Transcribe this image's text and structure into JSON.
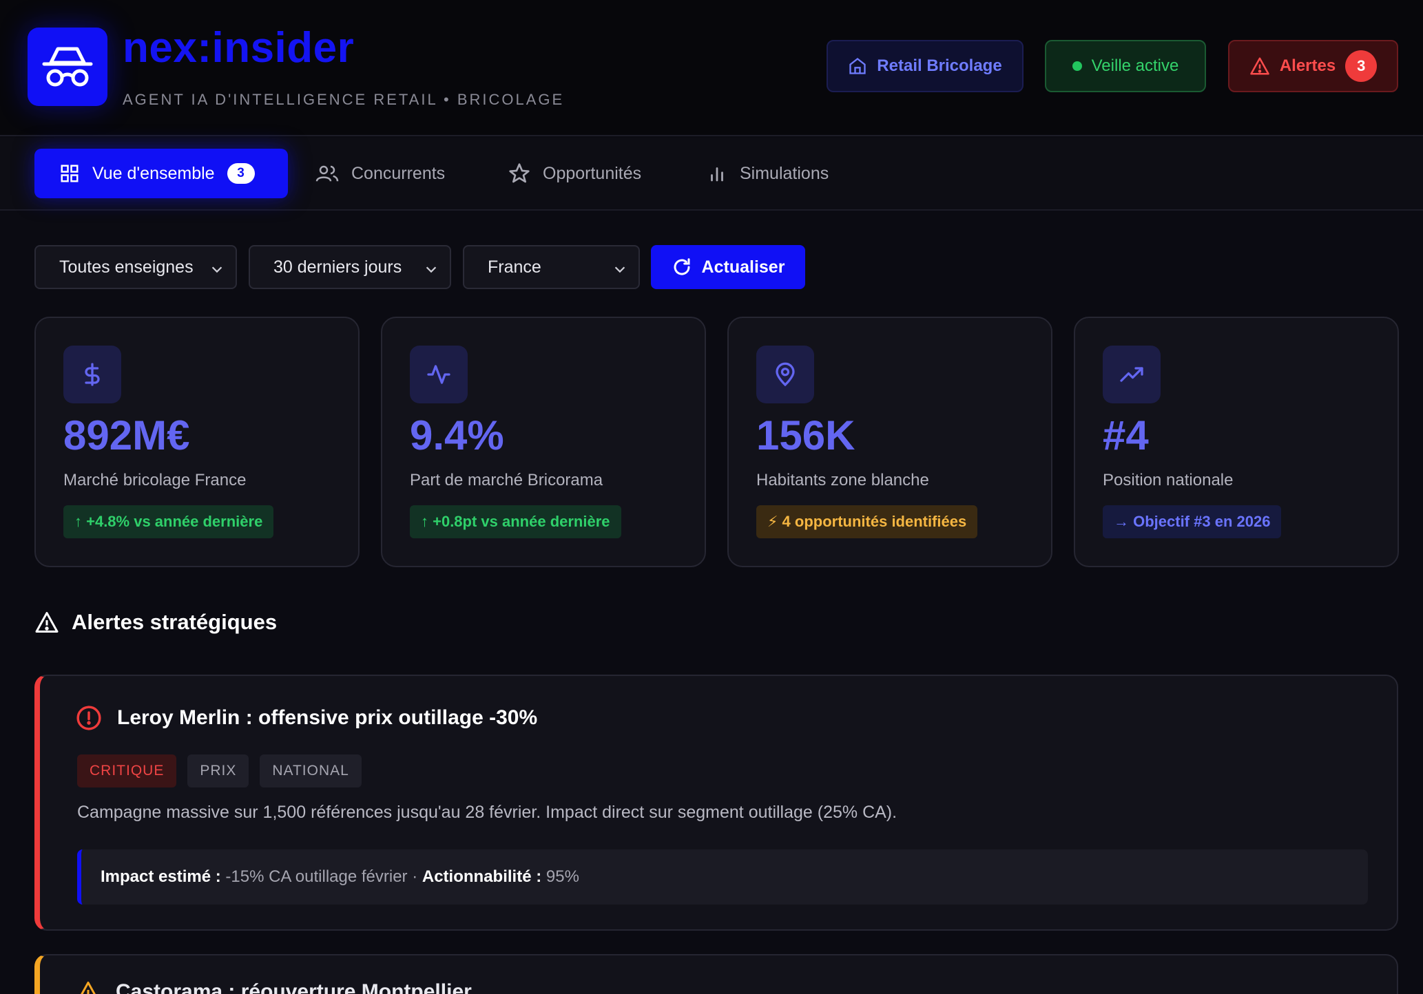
{
  "header": {
    "brand": "nex:insider",
    "subtitle": "AGENT IA D'INTELLIGENCE RETAIL • BRICOLAGE",
    "retail_label": "Retail Bricolage",
    "veille_label": "Veille active",
    "alertes_label": "Alertes",
    "alertes_count": "3"
  },
  "tabs": [
    {
      "label": "Vue d'ensemble",
      "badge": "3",
      "icon": "grid-icon"
    },
    {
      "label": "Concurrents",
      "icon": "users-icon"
    },
    {
      "label": "Opportunités",
      "icon": "star-icon"
    },
    {
      "label": "Simulations",
      "icon": "bar-chart-icon"
    }
  ],
  "filters": {
    "enseignes": "Toutes enseignes",
    "period": "30 derniers jours",
    "region": "France",
    "refresh_label": "Actualiser"
  },
  "kpis": [
    {
      "icon": "dollar-icon",
      "value": "892M€",
      "label": "Marché bricolage France",
      "pill": "↑ +4.8% vs année dernière",
      "pill_color": "#2fd06a"
    },
    {
      "icon": "activity-icon",
      "value": "9.4%",
      "label": "Part de marché Bricorama",
      "pill": "↑ +0.8pt vs année dernière",
      "pill_color": "#2fd06a"
    },
    {
      "icon": "map-pin-icon",
      "value": "156K",
      "label": "Habitants zone blanche",
      "pill": "⚡ 4 opportunités identifiées",
      "pill_color": "#f5b642"
    },
    {
      "icon": "trending-up-icon",
      "value": "#4",
      "label": "Position nationale",
      "pill": "→ Objectif #3 en 2026",
      "pill_color": "#6a74ff"
    }
  ],
  "section": {
    "title": "Alertes stratégiques"
  },
  "alerts": [
    {
      "title": "Leroy Merlin : offensive prix outillage -30%",
      "tags": [
        "CRITIQUE",
        "PRIX",
        "NATIONAL"
      ],
      "description": "Campagne massive sur 1,500 références jusqu'au 28 février. Impact direct sur segment outillage (25% CA).",
      "impact_label": "Impact estimé :",
      "impact_value": "-15% CA outillage février ·",
      "action_label": "Actionnabilité :",
      "action_value": "95%"
    },
    {
      "title": "Castorama : réouverture Montpellier"
    }
  ],
  "colors": {
    "accent": "#1010f5",
    "kpi_value": "#6366f1",
    "critical": "#ef3b3b",
    "warning": "#f5a623"
  }
}
